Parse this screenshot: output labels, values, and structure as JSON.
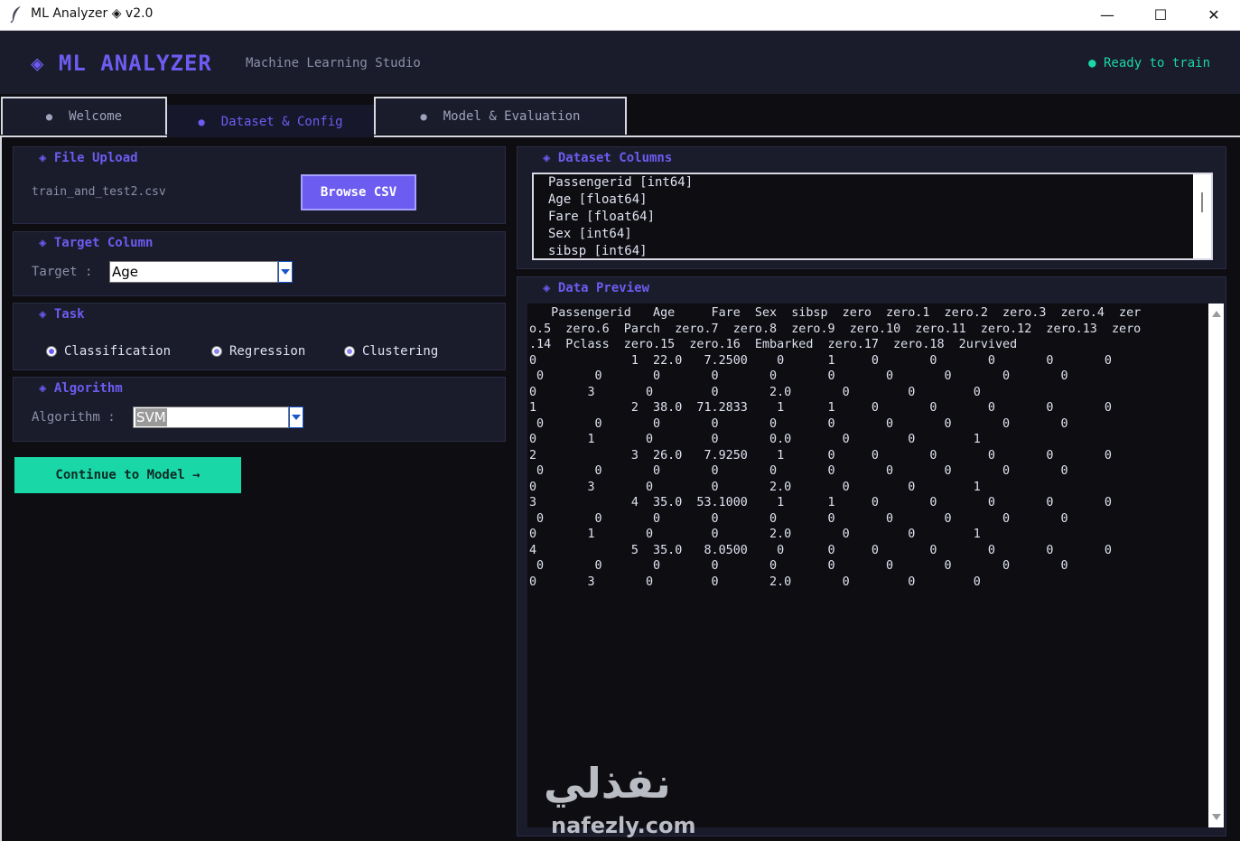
{
  "window": {
    "title": "ML Analyzer ◈ v2.0",
    "minimize": "—",
    "maximize": "☐",
    "close": "✕"
  },
  "header": {
    "logo": "◈  ML ANALYZER",
    "subtitle": "Machine Learning Studio",
    "status": "● Ready to train"
  },
  "tabs": [
    {
      "dot": "●",
      "label": "Welcome"
    },
    {
      "dot": "●",
      "label": "Dataset & Config"
    },
    {
      "dot": "●",
      "label": "Model & Evaluation"
    }
  ],
  "file_upload": {
    "title": "◈  File Upload",
    "filename": "train_and_test2.csv",
    "browse_label": "Browse CSV"
  },
  "target_column": {
    "title": "◈  Target Column",
    "label": "Target :",
    "value": "Age"
  },
  "task": {
    "title": "◈  Task",
    "options": [
      "Classification",
      "Regression",
      "Clustering"
    ]
  },
  "algorithm": {
    "title": "◈  Algorithm",
    "label": "Algorithm :",
    "value": "SVM"
  },
  "continue_label": "Continue to Model  →",
  "dataset_columns": {
    "title": "◈  Dataset Columns",
    "items": [
      "Passengerid  [int64]",
      "Age  [float64]",
      "Fare  [float64]",
      "Sex  [int64]",
      "sibsp  [int64]"
    ]
  },
  "data_preview": {
    "title": "◈  Data Preview",
    "text": "   Passengerid   Age     Fare  Sex  sibsp  zero  zero.1  zero.2  zero.3  zero.4  zer\no.5  zero.6  Parch  zero.7  zero.8  zero.9  zero.10  zero.11  zero.12  zero.13  zero\n.14  Pclass  zero.15  zero.16  Embarked  zero.17  zero.18  2urvived\n0             1  22.0   7.2500    0      1     0       0       0       0       0\n 0       0       0       0       0       0       0       0       0       0\n0       3       0        0       2.0       0        0        0\n1             2  38.0  71.2833    1      1     0       0       0       0       0\n 0       0       0       0       0       0       0       0       0       0\n0       1       0        0       0.0       0        0        1\n2             3  26.0   7.9250    1      0     0       0       0       0       0\n 0       0       0       0       0       0       0       0       0       0\n0       3       0        0       2.0       0        0        1\n3             4  35.0  53.1000    1      1     0       0       0       0       0\n 0       0       0       0       0       0       0       0       0       0\n0       1       0        0       2.0       0        0        1\n4             5  35.0   8.0500    0      0     0       0       0       0       0\n 0       0       0       0       0       0       0       0       0       0\n0       3       0        0       2.0       0        0        0"
  },
  "watermark": {
    "arabic": "نفذلي",
    "latin": "nafezly.com"
  },
  "colors": {
    "accent": "#6c5cf0",
    "success": "#1ad7a8",
    "panel": "#1a1b2b",
    "background": "#0d0d12"
  }
}
